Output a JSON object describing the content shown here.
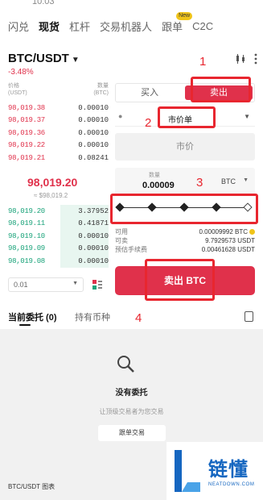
{
  "status": {
    "time": "10:03"
  },
  "top_tabs": [
    {
      "label": "闪兑"
    },
    {
      "label": "现货"
    },
    {
      "label": "杠杆"
    },
    {
      "label": "交易机器人"
    },
    {
      "label": "跟单",
      "badge": "New"
    },
    {
      "label": "C2C"
    }
  ],
  "pair": {
    "name": "BTC/USDT",
    "change": "-3.48%"
  },
  "order_book": {
    "price_header": "价格\n(USDT)",
    "qty_header": "数量\n(BTC)",
    "asks": [
      {
        "price": "98,019.38",
        "qty": "0.00010"
      },
      {
        "price": "98,019.37",
        "qty": "0.00010"
      },
      {
        "price": "98,019.36",
        "qty": "0.00010"
      },
      {
        "price": "98,019.22",
        "qty": "0.00010"
      },
      {
        "price": "98,019.21",
        "qty": "0.08241"
      }
    ],
    "mid_price": "98,019.20",
    "mid_approx": "≈ $98,019.2",
    "bids": [
      {
        "price": "98,019.20",
        "qty": "3.37952"
      },
      {
        "price": "98,019.11",
        "qty": "0.41871"
      },
      {
        "price": "98,019.10",
        "qty": "0.00010"
      },
      {
        "price": "98,019.09",
        "qty": "0.00010"
      },
      {
        "price": "98,019.08",
        "qty": "0.00010"
      }
    ],
    "depth": "0.01"
  },
  "form": {
    "buy_label": "买入",
    "sell_label": "卖出",
    "order_type": "市价单",
    "price_placeholder": "市价",
    "qty_label": "数量",
    "qty_value": "0.00009",
    "qty_unit": "BTC",
    "slider_percent": 100,
    "available_label": "可用",
    "available_value": "0.00009992 BTC",
    "sellable_label": "可卖",
    "sellable_value": "9.7929573 USDT",
    "fee_label": "预估手续费",
    "fee_value": "0.00461628 USDT",
    "submit_label": "卖出 BTC"
  },
  "annotations": [
    "1",
    "2",
    "3",
    "4"
  ],
  "orders": {
    "current_tab": "当前委托 (0)",
    "holdings_tab": "持有币种",
    "empty_title": "没有委托",
    "empty_sub": "让顶级交易者为您交易",
    "copy_button": "跟单交易"
  },
  "chart_link": "BTC/USDT 图表",
  "watermark": {
    "name": "链懂",
    "domain": "NEATDOWN.COM"
  },
  "colors": {
    "sell": "#e0314b",
    "buy": "#1aa37a",
    "annotation": "#e8262f"
  }
}
